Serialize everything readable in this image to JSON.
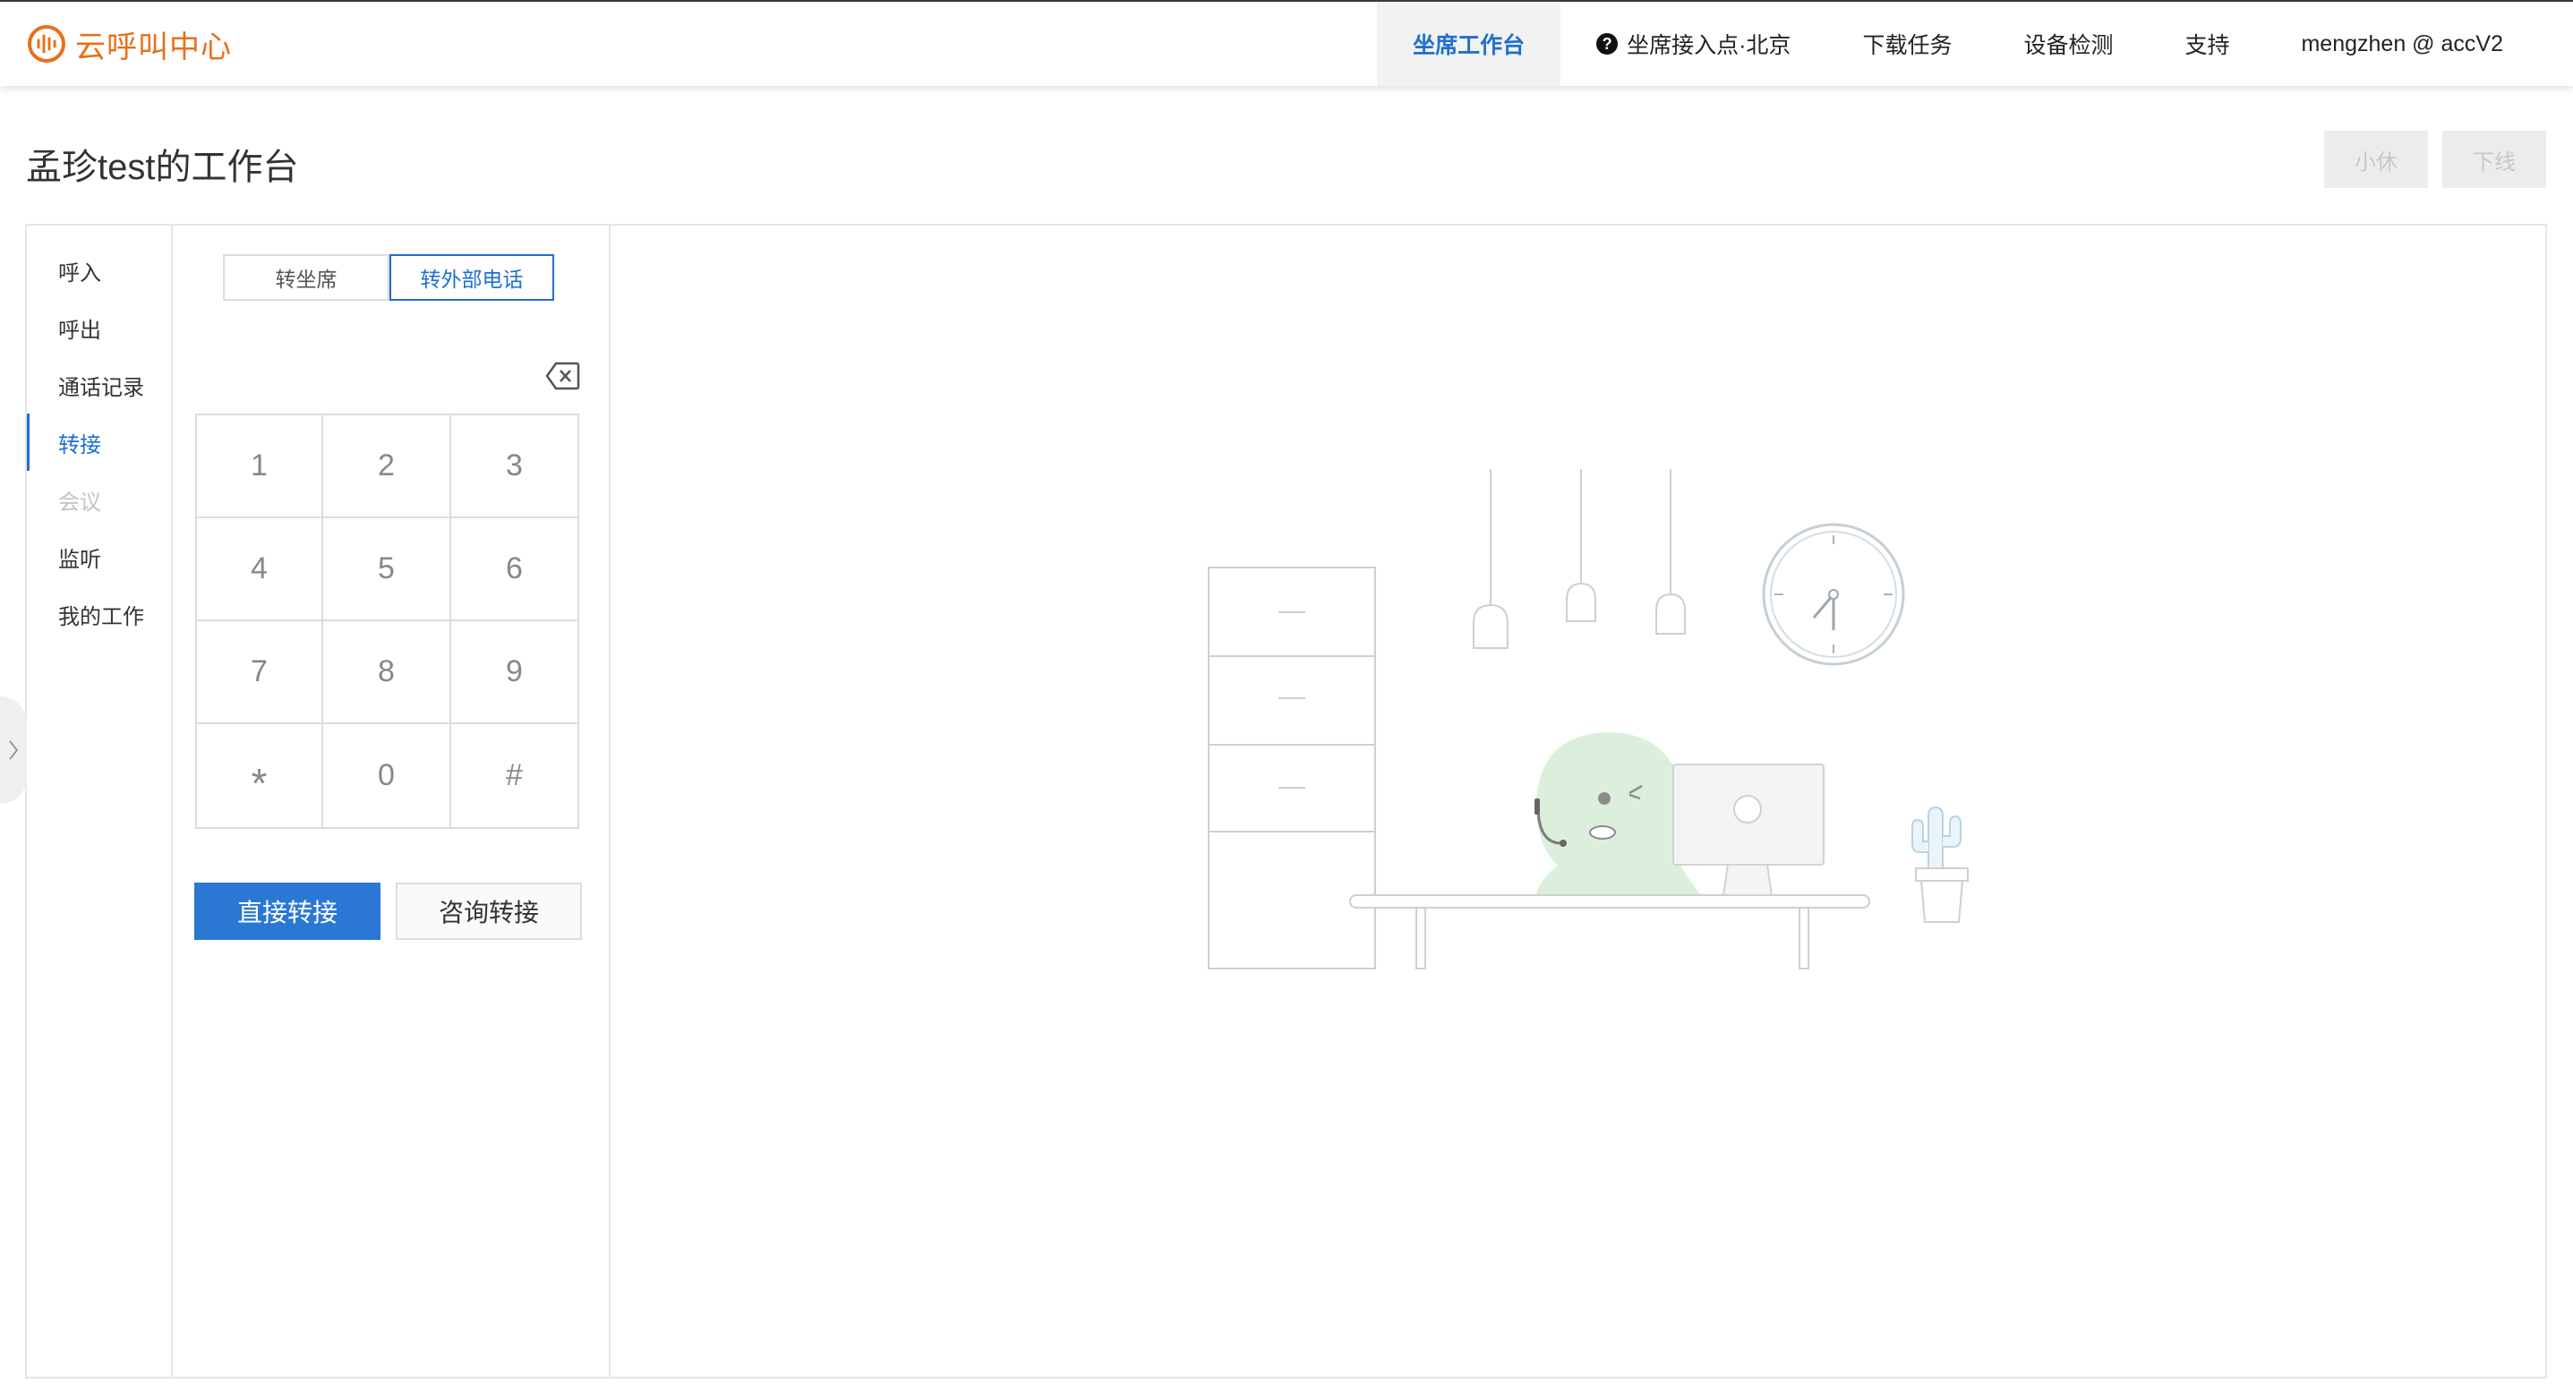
{
  "brand": {
    "name": "云呼叫中心",
    "color": "#e8701a"
  },
  "nav": {
    "workbench": "坐席工作台",
    "region": "坐席接入点·北京",
    "downloads": "下载任务",
    "device_check": "设备检测",
    "support": "支持",
    "user": "mengzhen @ accV2"
  },
  "page": {
    "title": "孟珍test的工作台",
    "rest_label": "小休",
    "offline_label": "下线"
  },
  "sidebar": {
    "items": [
      {
        "label": "呼入",
        "state": "normal"
      },
      {
        "label": "呼出",
        "state": "normal"
      },
      {
        "label": "通话记录",
        "state": "normal"
      },
      {
        "label": "转接",
        "state": "active"
      },
      {
        "label": "会议",
        "state": "disabled"
      },
      {
        "label": "监听",
        "state": "normal"
      },
      {
        "label": "我的工作",
        "state": "normal"
      }
    ]
  },
  "transfer": {
    "tab_agent": "转坐席",
    "tab_external": "转外部电话",
    "keys": [
      "1",
      "2",
      "3",
      "4",
      "5",
      "6",
      "7",
      "8",
      "9",
      "*",
      "0",
      "#"
    ],
    "direct_label": "直接转接",
    "consult_label": "咨询转接"
  },
  "colors": {
    "accent": "#1f6fcf",
    "primary_button": "#2b78d4"
  },
  "icons": {
    "help": "question-circle-icon",
    "backspace": "backspace-icon",
    "drawer": "chevron-right-icon"
  }
}
